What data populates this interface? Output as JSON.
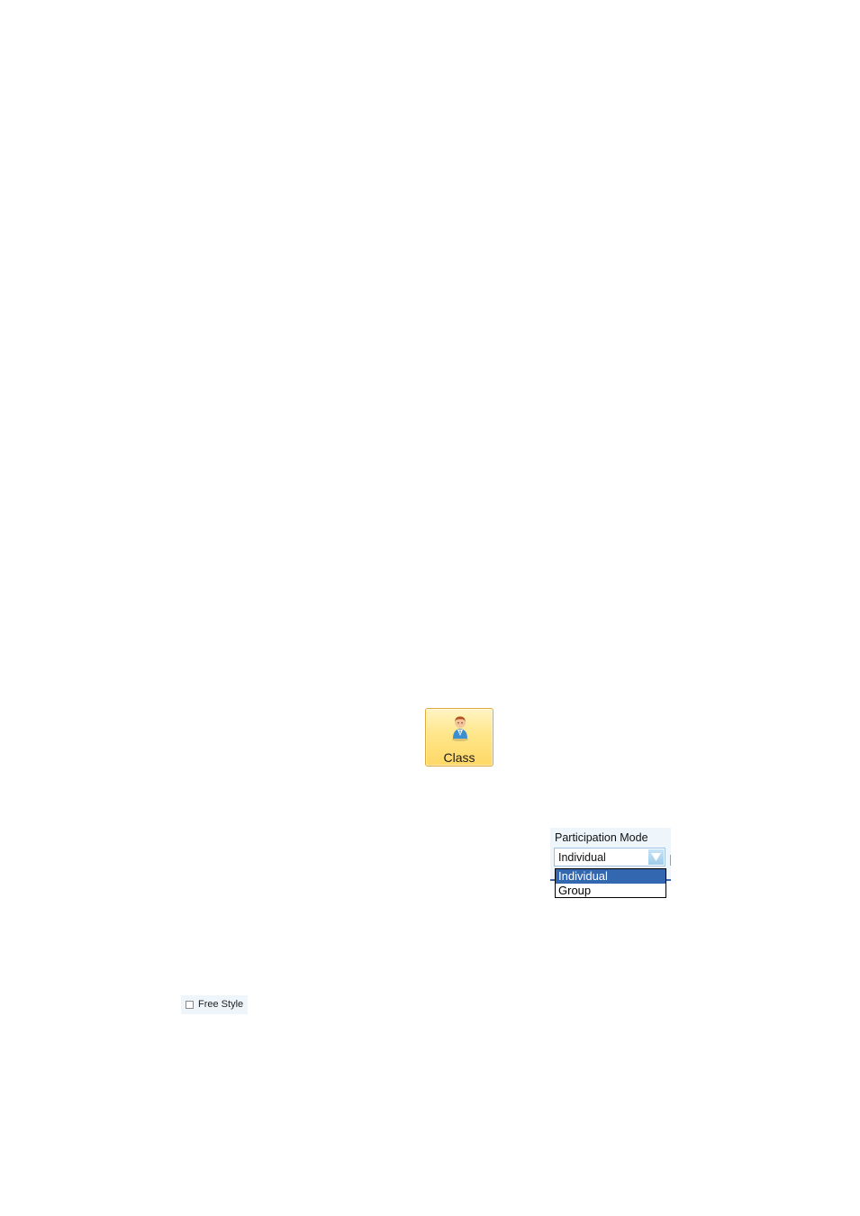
{
  "toolbar": {
    "class_button": {
      "label": "Class",
      "icon": "person-icon",
      "colors": {
        "fill": "#ffe68a",
        "border": "#e0a93a"
      }
    }
  },
  "participation_mode": {
    "label": "Participation Mode",
    "selected_value": "Individual",
    "dropdown_open": true,
    "options": [
      {
        "label": "Individual",
        "highlighted": true
      },
      {
        "label": "Group",
        "highlighted": false
      }
    ],
    "colors": {
      "highlight": "#3367b0",
      "panel_bg": "#eef5fb"
    }
  },
  "free_style": {
    "label": "Free Style",
    "checked": false
  }
}
